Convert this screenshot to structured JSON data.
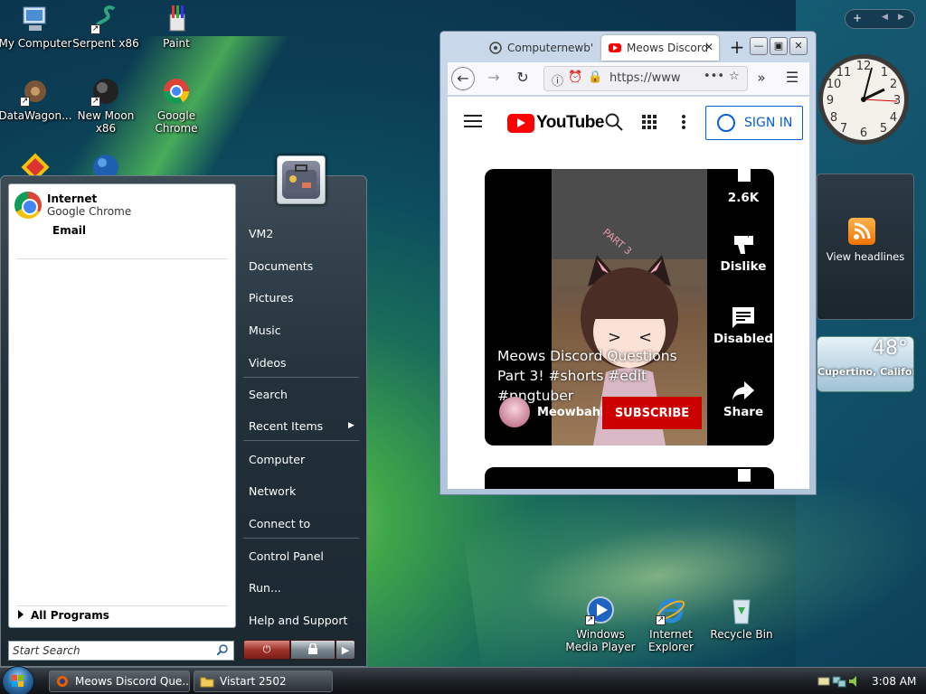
{
  "desktop": {
    "icons": [
      {
        "label": "My Computer",
        "icon": "computer-icon"
      },
      {
        "label": "Serpent x86",
        "icon": "serpent-icon"
      },
      {
        "label": "Paint",
        "icon": "paint-icon"
      },
      {
        "label": "DataWagon...",
        "icon": "datawagon-icon"
      },
      {
        "label": "New Moon x86",
        "icon": "moon-icon"
      },
      {
        "label": "Google Chrome",
        "icon": "chrome-icon"
      },
      {
        "label": "Windows Media Player",
        "icon": "media-player-icon"
      },
      {
        "label": "Internet Explorer",
        "icon": "ie-icon"
      },
      {
        "label": "Recycle Bin",
        "icon": "recycle-bin-icon"
      }
    ]
  },
  "start_menu": {
    "pinned": {
      "title": "Internet",
      "subtitle": "Google Chrome"
    },
    "email": "Email",
    "all_programs": "All Programs",
    "search_placeholder": "Start Search",
    "right_items": [
      "VM2",
      "Documents",
      "Pictures",
      "Music",
      "Videos",
      "Search",
      "Recent Items",
      "Computer",
      "Network",
      "Connect to",
      "Control Panel",
      "Run...",
      "Help and Support"
    ]
  },
  "browser": {
    "tabs": [
      {
        "label": "Computernewb'",
        "active": false
      },
      {
        "label": "Meows Discord",
        "active": true
      }
    ],
    "url": "https://www",
    "window_buttons": [
      "minimize",
      "maximize",
      "close"
    ],
    "youtube": {
      "logo": "YouTube",
      "sign_in": "SIGN IN",
      "short": {
        "title": "Meows Discord Questions Part 3! #shorts #edit #pngtuber",
        "channel": "Meowbahh",
        "subscribe": "SUBSCRIBE",
        "overlay_text": "PART 3",
        "actions": [
          {
            "label": "2.6K",
            "icon": "like-icon"
          },
          {
            "label": "Dislike",
            "icon": "dislike-icon"
          },
          {
            "label": "Disabled",
            "icon": "comment-icon"
          },
          {
            "label": "Share",
            "icon": "share-icon"
          }
        ]
      }
    }
  },
  "gadgets": {
    "feed_label": "View headlines",
    "weather": {
      "temp": "48°",
      "location": "Cupertino, California"
    }
  },
  "taskbar": {
    "buttons": [
      {
        "label": "Meows Discord Que...",
        "icon": "firefox-icon"
      },
      {
        "label": "Vistart 2502",
        "icon": "folder-icon"
      }
    ],
    "time": "3:08 AM"
  },
  "colors": {
    "youtube_red": "#ff0000",
    "subscribe_red": "#cc0000",
    "signin_blue": "#065fd4"
  }
}
